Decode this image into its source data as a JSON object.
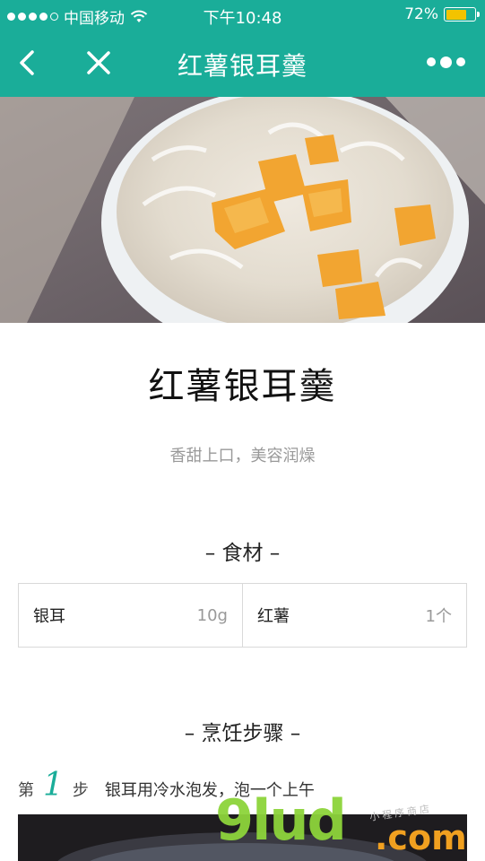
{
  "status_bar": {
    "carrier": "中国移动",
    "time": "下午10:48",
    "battery": "72%",
    "battery_level": 0.72
  },
  "navbar": {
    "title": "红薯银耳羹",
    "back_icon": "chevron-left-icon",
    "close_icon": "close-icon",
    "more_icon": "more-dots-icon"
  },
  "recipe": {
    "title": "红薯银耳羹",
    "subtitle": "香甜上口，美容润燥"
  },
  "ingredients": {
    "heading": "– 食材 –",
    "items": [
      {
        "name": "银耳",
        "amount": "10g"
      },
      {
        "name": "红薯",
        "amount": "1个"
      }
    ]
  },
  "steps": {
    "heading": "– 烹饪步骤 –",
    "items": [
      {
        "prefix": "第",
        "number": "1",
        "suffix": "步",
        "text": "银耳用冷水泡发，泡一个上午"
      }
    ]
  },
  "watermark": {
    "main": "9lud",
    "domain": ".com",
    "small": "小程序商店"
  },
  "colors": {
    "accent": "#1aad99",
    "battery": "#f3c300"
  }
}
